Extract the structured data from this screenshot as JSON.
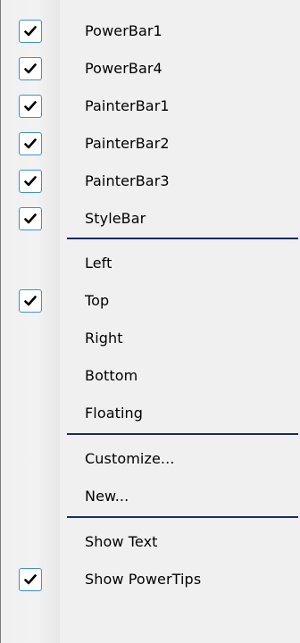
{
  "menu": {
    "items": [
      {
        "label": "PowerBar1",
        "checked": true
      },
      {
        "label": "PowerBar4",
        "checked": true
      },
      {
        "label": "PainterBar1",
        "checked": true
      },
      {
        "label": "PainterBar2",
        "checked": true
      },
      {
        "label": "PainterBar3",
        "checked": true
      },
      {
        "label": "StyleBar",
        "checked": true
      },
      {
        "label": "Left",
        "checked": false
      },
      {
        "label": "Top",
        "checked": true
      },
      {
        "label": "Right",
        "checked": false
      },
      {
        "label": "Bottom",
        "checked": false
      },
      {
        "label": "Floating",
        "checked": false
      },
      {
        "label": "Customize...",
        "checked": false
      },
      {
        "label": "New...",
        "checked": false
      },
      {
        "label": "Show Text",
        "checked": false
      },
      {
        "label": "Show PowerTips",
        "checked": true
      }
    ]
  },
  "icons": {
    "check": "checkmark-icon"
  },
  "colors": {
    "menu_background": "#f0f0f0",
    "check_border": "#3d8fd6",
    "separator": "#1a2a66"
  }
}
